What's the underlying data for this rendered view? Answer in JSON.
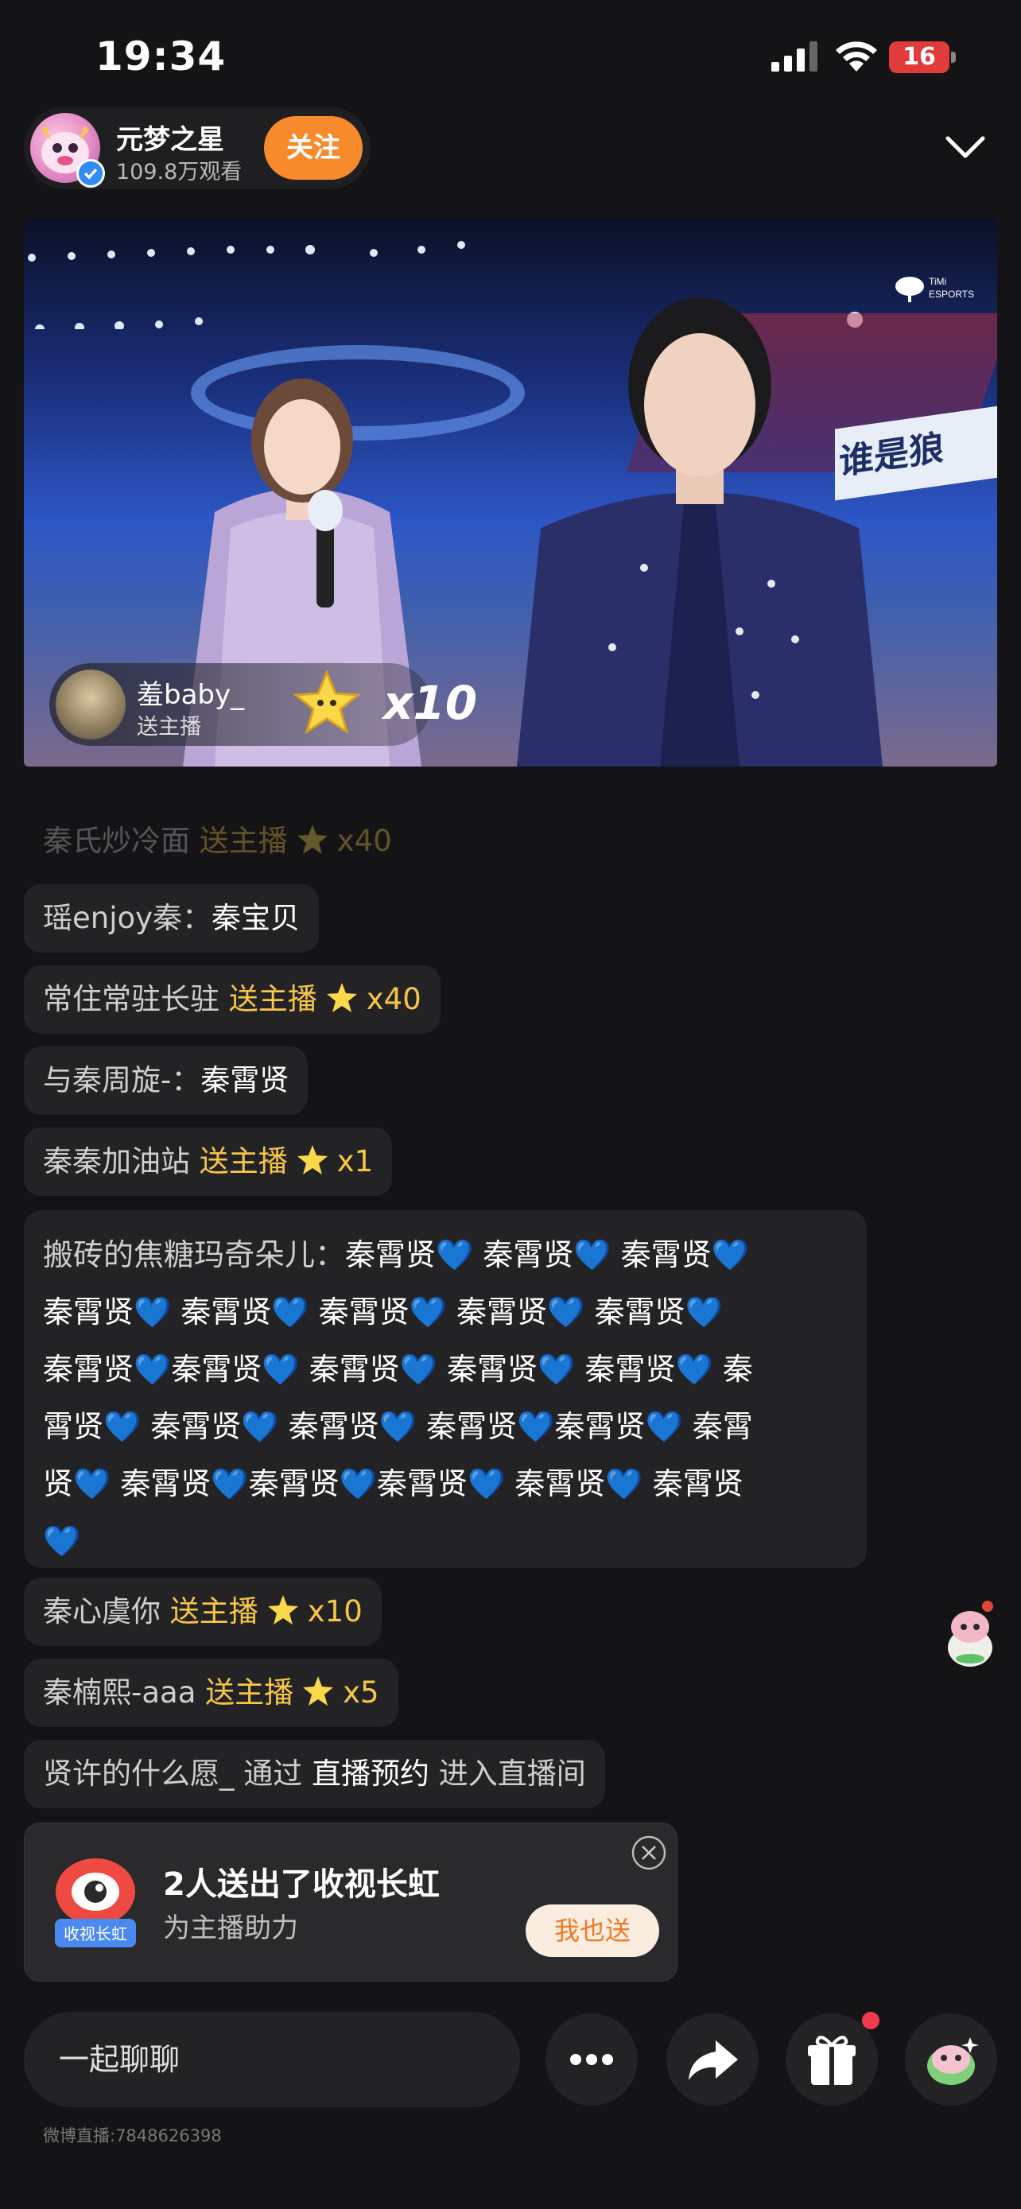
{
  "status_bar": {
    "time": "19:34",
    "battery": "16"
  },
  "header": {
    "streamer_name": "元梦之星",
    "viewer_count": "109.8万观看",
    "follow_label": "关注"
  },
  "video": {
    "brand": "TiMi ESPORTS",
    "sign_text": "谁是狼",
    "gift_banner": {
      "sender": "羞baby_",
      "action": "送主播",
      "count": "x10"
    }
  },
  "chat": {
    "faded": {
      "user": "秦氏炒冷面",
      "action": "送主播",
      "count": "x40"
    },
    "messages": [
      {
        "user": "瑶enjoy秦：",
        "content": "秦宝贝"
      },
      {
        "user": "常住常驻长驻",
        "action": "送主播",
        "count": "x40"
      },
      {
        "user": "与秦周旋-：",
        "content": "秦霄贤"
      },
      {
        "user": "秦秦加油站",
        "action": "送主播",
        "count": "x1"
      }
    ],
    "long_message": {
      "user": "搬砖的焦糖玛奇朵儿：",
      "lines": [
        "秦霄贤💙 秦霄贤💙 秦霄贤💙",
        "秦霄贤💙 秦霄贤💙 秦霄贤💙 秦霄贤💙 秦霄贤💙",
        "秦霄贤💙秦霄贤💙 秦霄贤💙 秦霄贤💙 秦霄贤💙 秦",
        "霄贤💙 秦霄贤💙 秦霄贤💙 秦霄贤💙秦霄贤💙 秦霄",
        "贤💙 秦霄贤💙秦霄贤💙秦霄贤💙 秦霄贤💙 秦霄贤",
        "💙"
      ]
    },
    "gift_msgs": [
      {
        "user": "秦心虞你",
        "action": "送主播",
        "count": "x10"
      },
      {
        "user": "秦楠熙-aaa",
        "action": "送主播",
        "count": "x5"
      }
    ],
    "entry_msg": {
      "user": "贤许的什么愿_",
      "via": "通过",
      "source": "直播预约",
      "suffix": "进入直播间"
    }
  },
  "promo": {
    "icon_label": "收视长虹",
    "title": "2人送出了收视长虹",
    "subtitle": "为主播助力",
    "button": "我也送"
  },
  "bottom": {
    "input_placeholder": "一起聊聊",
    "room_id": "微博直播:7848626398"
  },
  "colors": {
    "accent": "#f78a2a",
    "gift_text": "#f7c548",
    "background": "#141416"
  },
  "icons": [
    "signal-icon",
    "wifi-icon",
    "chevron-down-icon",
    "star-gift-icon",
    "more-icon",
    "share-icon",
    "gift-icon",
    "mascot-icon",
    "close-icon"
  ]
}
